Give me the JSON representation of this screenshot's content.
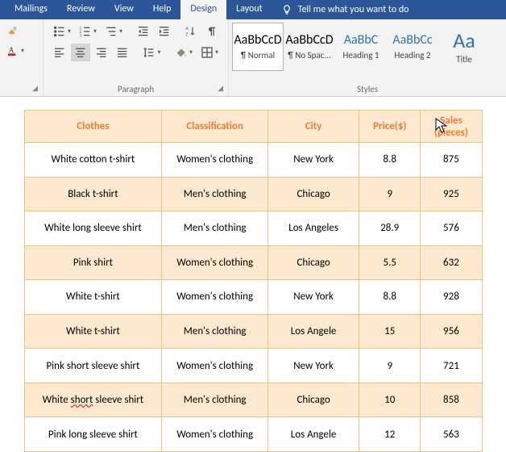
{
  "ribbon": {
    "tabs": [
      "Mailings",
      "Review",
      "View",
      "Help",
      "Design",
      "Layout"
    ],
    "active_tab": 4,
    "tell_me": "Tell me what you want to do"
  },
  "paragraph_group": {
    "label": "Paragraph"
  },
  "styles_group": {
    "label": "Styles",
    "tiles": [
      {
        "preview": "AaBbCcD",
        "name": "¶ Normal",
        "selected": true
      },
      {
        "preview": "AaBbCcD",
        "name": "¶ No Spac..."
      },
      {
        "preview": "AaBbC",
        "name": "Heading 1",
        "cls": "hdg1"
      },
      {
        "preview": "AaBbCc",
        "name": "Heading 2",
        "cls": "hdg2"
      },
      {
        "preview": "Aa",
        "name": "Title",
        "cls": "tit"
      }
    ]
  },
  "table": {
    "headers": [
      "Clothes",
      "Classification",
      "City",
      "Price($)",
      "Sales (pieces)"
    ],
    "rows": [
      [
        "White cotton t-shirt",
        "Women's clothing",
        "New York",
        "8.8",
        "875"
      ],
      [
        "Black t-shirt",
        "Men's clothing",
        "Chicago",
        "9",
        "925"
      ],
      [
        "White long sleeve shirt",
        "Men's clothing",
        "Los Angeles",
        "28.9",
        "576"
      ],
      [
        "Pink shirt",
        "Women's clothing",
        "Chicago",
        "5.5",
        "632"
      ],
      [
        "White t-shirt",
        "Women's clothing",
        "New York",
        "8.8",
        "928"
      ],
      [
        "White t-shirt",
        "Men's clothing",
        "Los Angele",
        "15",
        "956"
      ],
      [
        "Pink short sleeve shirt",
        "Women's clothing",
        "New York",
        "9",
        "721"
      ],
      [
        "White short sleeve shirt",
        "Men's clothing",
        "Chicago",
        "10",
        "858"
      ],
      [
        "Pink long sleeve shirt",
        "Women's clothing",
        "Los Angele",
        "12",
        "563"
      ]
    ],
    "squiggle": {
      "row": 7,
      "col": 0,
      "word": "short"
    }
  }
}
